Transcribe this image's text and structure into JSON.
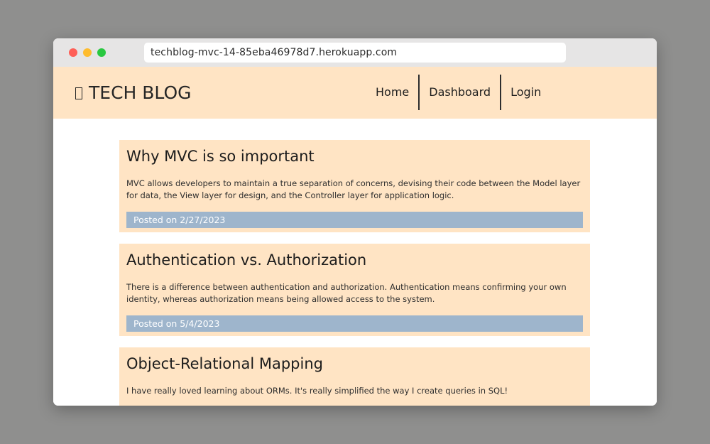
{
  "browser": {
    "url": "techblog-mvc-14-85eba46978d7.herokuapp.com"
  },
  "header": {
    "logo_icon": "unknown-glyph-icon",
    "logo_text": "TECH BLOG",
    "nav": {
      "home": "Home",
      "dashboard": "Dashboard",
      "login": "Login"
    }
  },
  "colors": {
    "header_bg": "#ffe4c4",
    "post_bg": "#ffe4c4",
    "date_bar_bg": "#9eb5cc"
  },
  "posts": [
    {
      "title": "Why MVC is so important",
      "body": "MVC allows developers to maintain a true separation of concerns, devising their code between the Model layer for data, the View layer for design, and the Controller layer for application logic.",
      "posted": "Posted on 2/27/2023"
    },
    {
      "title": "Authentication vs. Authorization",
      "body": "There is a difference between authentication and authorization. Authentication means confirming your own identity, whereas authorization means being allowed access to the system.",
      "posted": "Posted on 5/4/2023"
    },
    {
      "title": "Object-Relational Mapping",
      "body": "I have really loved learning about ORMs. It's really simplified the way I create queries in SQL!"
    }
  ]
}
